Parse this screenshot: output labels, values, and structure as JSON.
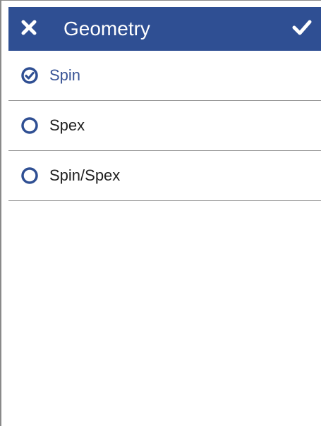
{
  "header": {
    "title": "Geometry",
    "close_icon": "close-icon",
    "confirm_icon": "checkmark-icon"
  },
  "options": [
    {
      "label": "Spin",
      "selected": true
    },
    {
      "label": "Spex",
      "selected": false
    },
    {
      "label": "Spin/Spex",
      "selected": false
    }
  ],
  "colors": {
    "header_bg": "#2f4f93",
    "accent": "#3a5596",
    "divider": "#9a9a9a"
  }
}
